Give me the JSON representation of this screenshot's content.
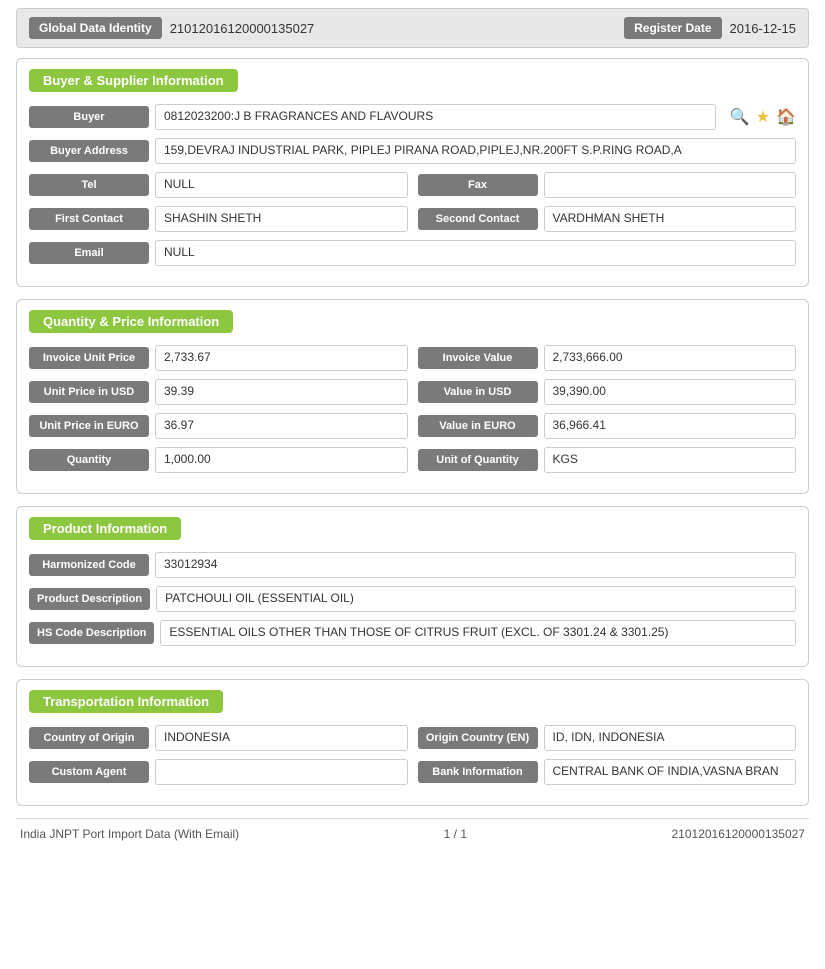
{
  "topbar": {
    "label1": "Global Data Identity",
    "value1": "21012016120000135027",
    "label2": "Register Date",
    "value2": "2016-12-15"
  },
  "sections": {
    "buyer_supplier": {
      "title": "Buyer & Supplier Information",
      "fields": {
        "buyer_label": "Buyer",
        "buyer_value": "0812023200:J B FRAGRANCES AND FLAVOURS",
        "buyer_address_label": "Buyer Address",
        "buyer_address_value": "159,DEVRAJ INDUSTRIAL PARK, PIPLEJ PIRANA ROAD,PIPLEJ,NR.200FT S.P.RING ROAD,A",
        "tel_label": "Tel",
        "tel_value": "NULL",
        "fax_label": "Fax",
        "fax_value": "",
        "first_contact_label": "First Contact",
        "first_contact_value": "SHASHIN SHETH",
        "second_contact_label": "Second Contact",
        "second_contact_value": "VARDHMAN SHETH",
        "email_label": "Email",
        "email_value": "NULL"
      }
    },
    "quantity_price": {
      "title": "Quantity & Price Information",
      "fields": {
        "invoice_unit_price_label": "Invoice Unit Price",
        "invoice_unit_price_value": "2,733.67",
        "invoice_value_label": "Invoice Value",
        "invoice_value_value": "2,733,666.00",
        "unit_price_usd_label": "Unit Price in USD",
        "unit_price_usd_value": "39.39",
        "value_usd_label": "Value in USD",
        "value_usd_value": "39,390.00",
        "unit_price_euro_label": "Unit Price in EURO",
        "unit_price_euro_value": "36.97",
        "value_euro_label": "Value in EURO",
        "value_euro_value": "36,966.41",
        "quantity_label": "Quantity",
        "quantity_value": "1,000.00",
        "unit_quantity_label": "Unit of Quantity",
        "unit_quantity_value": "KGS"
      }
    },
    "product": {
      "title": "Product Information",
      "fields": {
        "harmonized_code_label": "Harmonized Code",
        "harmonized_code_value": "33012934",
        "product_desc_label": "Product Description",
        "product_desc_value": "PATCHOULI OIL (ESSENTIAL OIL)",
        "hs_code_desc_label": "HS Code Description",
        "hs_code_desc_value": "ESSENTIAL OILS OTHER THAN THOSE OF CITRUS FRUIT (EXCL. OF 3301.24 & 3301.25)"
      }
    },
    "transportation": {
      "title": "Transportation Information",
      "fields": {
        "country_origin_label": "Country of Origin",
        "country_origin_value": "INDONESIA",
        "origin_country_en_label": "Origin Country (EN)",
        "origin_country_en_value": "ID, IDN, INDONESIA",
        "custom_agent_label": "Custom Agent",
        "custom_agent_value": "",
        "bank_info_label": "Bank Information",
        "bank_info_value": "CENTRAL BANK OF INDIA,VASNA BRAN"
      }
    }
  },
  "footer": {
    "left": "India JNPT Port Import Data (With Email)",
    "center": "1 / 1",
    "right": "21012016120000135027"
  }
}
